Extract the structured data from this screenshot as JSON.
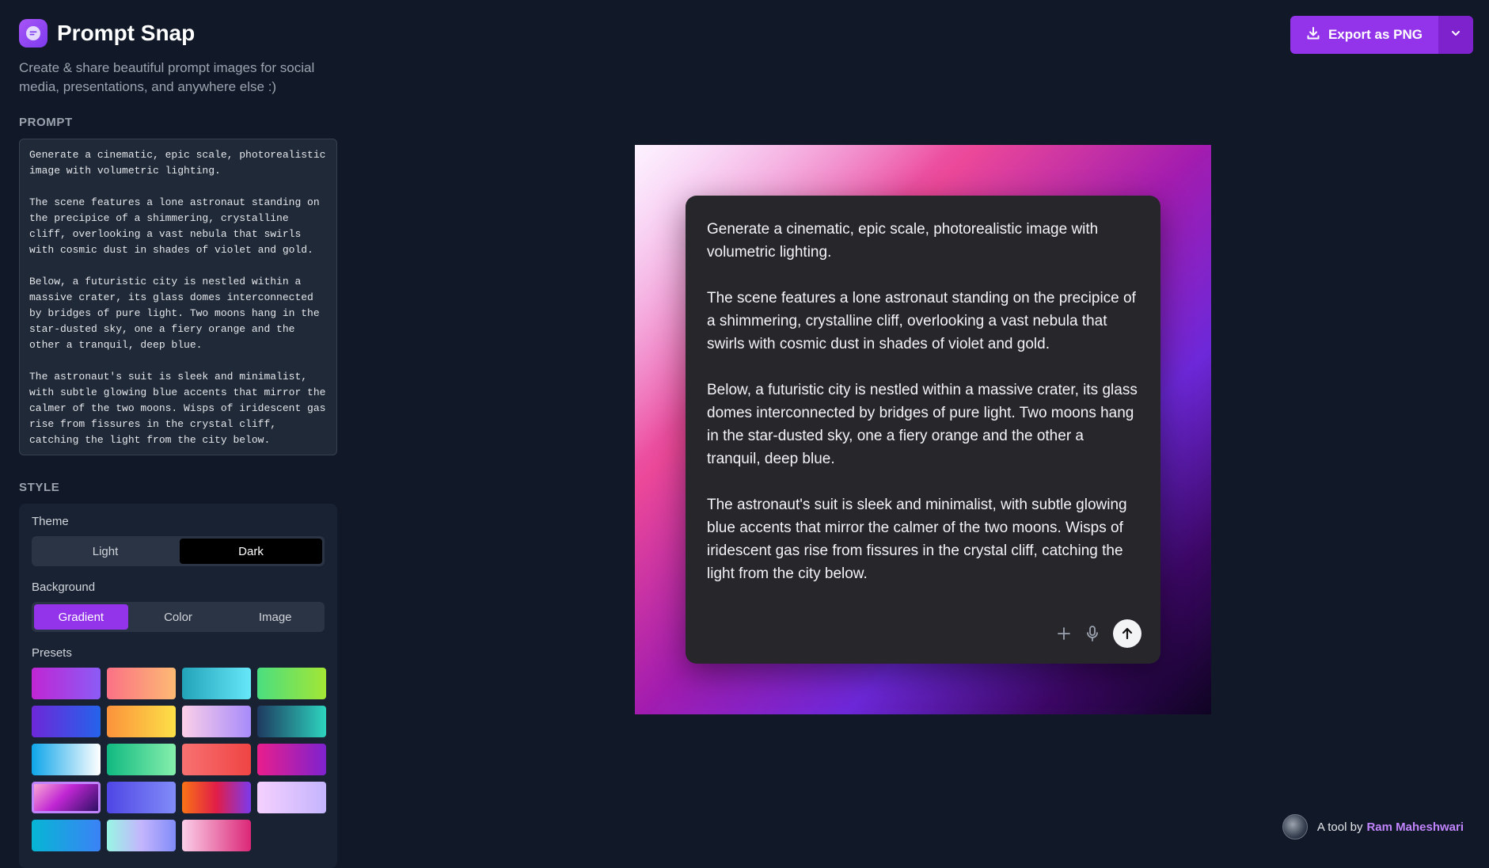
{
  "app": {
    "title": "Prompt Snap",
    "subtitle": "Create & share beautiful prompt images for social media, presentations, and anywhere else :)"
  },
  "prompt": {
    "label": "PROMPT",
    "text": "Generate a cinematic, epic scale, photorealistic image with volumetric lighting.\n\nThe scene features a lone astronaut standing on the precipice of a shimmering, crystalline cliff, overlooking a vast nebula that swirls with cosmic dust in shades of violet and gold.\n\nBelow, a futuristic city is nestled within a massive crater, its glass domes interconnected by bridges of pure light. Two moons hang in the star-dusted sky, one a fiery orange and the other a tranquil, deep blue.\n\nThe astronaut's suit is sleek and minimalist, with subtle glowing blue accents that mirror the calmer of the two moons. Wisps of iridescent gas rise from fissures in the crystal cliff, catching the light from the city below."
  },
  "style": {
    "label": "STYLE",
    "theme": {
      "label": "Theme",
      "options": [
        "Light",
        "Dark"
      ],
      "selected": "Dark"
    },
    "background": {
      "label": "Background",
      "options": [
        "Gradient",
        "Color",
        "Image"
      ],
      "selected": "Gradient"
    },
    "presets": {
      "label": "Presets",
      "selected_index": 12,
      "items": [
        "linear-gradient(90deg,#c026d3,#8b5cf6)",
        "linear-gradient(90deg,#fb7185,#fdba74)",
        "linear-gradient(90deg,#22a3b8,#67e8f9)",
        "linear-gradient(90deg,#4ade80,#a3e635)",
        "linear-gradient(90deg,#6d28d9,#2563eb)",
        "linear-gradient(90deg,#fb923c,#fde047)",
        "linear-gradient(90deg,#fbcfe8,#a78bfa)",
        "linear-gradient(90deg,#1e3a5f,#2dd4bf)",
        "linear-gradient(90deg,#0ea5e9,#ffffff)",
        "linear-gradient(90deg,#10b981,#86efac)",
        "linear-gradient(90deg,#f87171,#ef4444)",
        "linear-gradient(90deg,#e91e8c,#7e22ce)",
        "linear-gradient(135deg,#f9a8d4,#c026d3 45%,#2e1065)",
        "linear-gradient(90deg,#4f46e5,#818cf8)",
        "linear-gradient(90deg,#f97316,#e11d48,#7c3aed)",
        "linear-gradient(90deg,#f5d0fe,#c4b5fd)",
        "linear-gradient(90deg,#06b6d4,#3b82f6)",
        "linear-gradient(90deg,#99f6e4,#c4b5fd,#818cf8)",
        "linear-gradient(90deg,#fbcfe8,#db2777)"
      ]
    }
  },
  "export": {
    "label": "Export as PNG",
    "icon": "download-icon",
    "dropdown_icon": "chevron-down-icon"
  },
  "card": {
    "actions": {
      "add_icon": "plus-icon",
      "mic_icon": "microphone-icon",
      "send_icon": "arrow-up-icon"
    }
  },
  "footer": {
    "prefix": "A tool by",
    "author": "Ram Maheshwari"
  },
  "colors": {
    "accent": "#9333ea",
    "page_bg": "#111827",
    "card_bg": "#26262b",
    "panel_bg": "#1f2937"
  }
}
